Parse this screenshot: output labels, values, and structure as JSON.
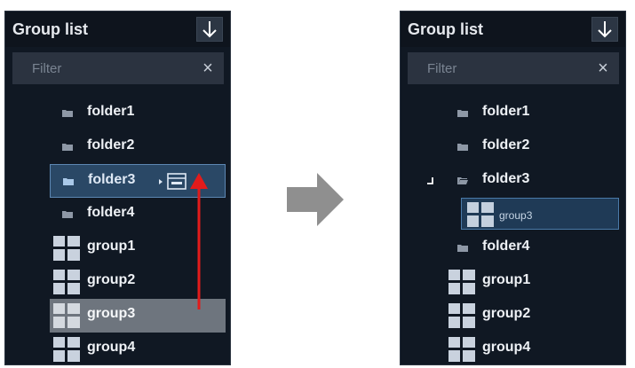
{
  "before": {
    "title": "Group list",
    "filter_placeholder": "Filter",
    "clear_symbol": "×",
    "items": [
      {
        "label": "folder1"
      },
      {
        "label": "folder2"
      },
      {
        "label": "folder3"
      },
      {
        "label": "folder4"
      },
      {
        "label": "group1"
      },
      {
        "label": "group2"
      },
      {
        "label": "group3"
      },
      {
        "label": "group4"
      }
    ]
  },
  "after": {
    "title": "Group list",
    "filter_placeholder": "Filter",
    "clear_symbol": "×",
    "items": [
      {
        "label": "folder1"
      },
      {
        "label": "folder2"
      },
      {
        "label": "folder3"
      },
      {
        "label": "group3"
      },
      {
        "label": "folder4"
      },
      {
        "label": "group1"
      },
      {
        "label": "group2"
      },
      {
        "label": "group4"
      }
    ]
  },
  "icons": {
    "header_button": "arrow-down-icon",
    "folder": "folder-icon",
    "group": "group-grid-icon",
    "drop_target": "group-drop-icon",
    "drag_arrow": "red-arrow-up-icon",
    "transition": "right-arrow-icon"
  },
  "colors": {
    "panel_bg": "#101823",
    "selection": "#2a4866",
    "drag_row": "#6e757e",
    "drag_arrow": "#e21b1b",
    "transition_arrow": "#8f8f8f"
  }
}
